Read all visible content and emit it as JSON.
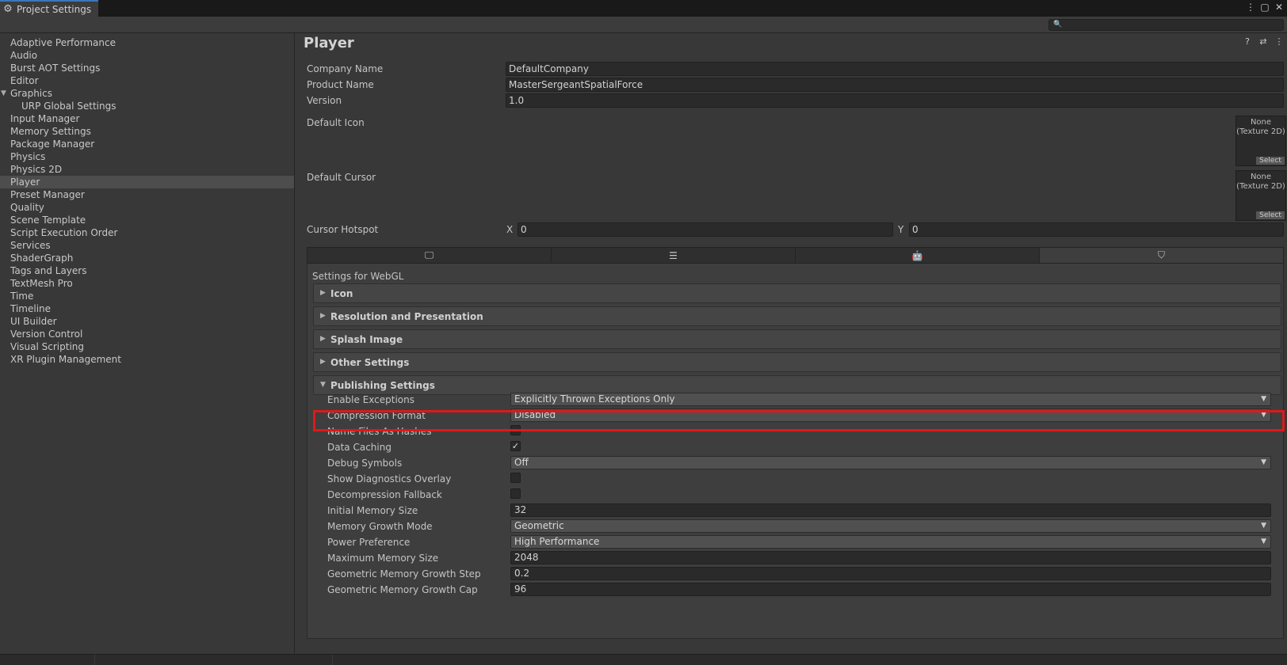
{
  "window": {
    "tab_title": "Project Settings"
  },
  "search": {
    "placeholder": ""
  },
  "sidebar": {
    "items": [
      {
        "label": "Adaptive Performance"
      },
      {
        "label": "Audio"
      },
      {
        "label": "Burst AOT Settings"
      },
      {
        "label": "Editor"
      },
      {
        "label": "Graphics"
      },
      {
        "label": "URP Global Settings"
      },
      {
        "label": "Input Manager"
      },
      {
        "label": "Memory Settings"
      },
      {
        "label": "Package Manager"
      },
      {
        "label": "Physics"
      },
      {
        "label": "Physics 2D"
      },
      {
        "label": "Player"
      },
      {
        "label": "Preset Manager"
      },
      {
        "label": "Quality"
      },
      {
        "label": "Scene Template"
      },
      {
        "label": "Script Execution Order"
      },
      {
        "label": "Services"
      },
      {
        "label": "ShaderGraph"
      },
      {
        "label": "Tags and Layers"
      },
      {
        "label": "TextMesh Pro"
      },
      {
        "label": "Time"
      },
      {
        "label": "Timeline"
      },
      {
        "label": "UI Builder"
      },
      {
        "label": "Version Control"
      },
      {
        "label": "Visual Scripting"
      },
      {
        "label": "XR Plugin Management"
      }
    ]
  },
  "player": {
    "title": "Player",
    "company_name_label": "Company Name",
    "company_name": "DefaultCompany",
    "product_name_label": "Product Name",
    "product_name": "MasterSergeantSpatialForce",
    "version_label": "Version",
    "version": "1.0",
    "default_icon_label": "Default Icon",
    "default_cursor_label": "Default Cursor",
    "texture_none": "None",
    "texture_type": "(Texture 2D)",
    "select_label": "Select",
    "cursor_hotspot_label": "Cursor Hotspot",
    "x_label": "X",
    "x_value": "0",
    "y_label": "Y",
    "y_value": "0",
    "settings_for": "Settings for WebGL"
  },
  "sections": {
    "icon": "Icon",
    "resolution": "Resolution and Presentation",
    "splash": "Splash Image",
    "other": "Other Settings",
    "publishing": "Publishing Settings"
  },
  "publishing": {
    "enable_exceptions_label": "Enable Exceptions",
    "enable_exceptions": "Explicitly Thrown Exceptions Only",
    "compression_format_label": "Compression Format",
    "compression_format": "Disabled",
    "name_files_as_hashes_label": "Name Files As Hashes",
    "data_caching_label": "Data Caching",
    "debug_symbols_label": "Debug Symbols",
    "debug_symbols": "Off",
    "show_diagnostics_label": "Show Diagnostics Overlay",
    "decompression_fallback_label": "Decompression Fallback",
    "initial_memory_label": "Initial Memory Size",
    "initial_memory": "32",
    "memory_growth_mode_label": "Memory Growth Mode",
    "memory_growth_mode": "Geometric",
    "power_preference_label": "Power Preference",
    "power_preference": "High Performance",
    "max_memory_label": "Maximum Memory Size",
    "max_memory": "2048",
    "geo_step_label": "Geometric Memory Growth Step",
    "geo_step": "0.2",
    "geo_cap_label": "Geometric Memory Growth Cap",
    "geo_cap": "96"
  },
  "checkboxes": {
    "name_files_as_hashes": false,
    "data_caching": true,
    "show_diagnostics_overlay": false,
    "decompression_fallback": false
  },
  "colors": {
    "highlight": "#e01818",
    "accent": "#3a79bb"
  }
}
